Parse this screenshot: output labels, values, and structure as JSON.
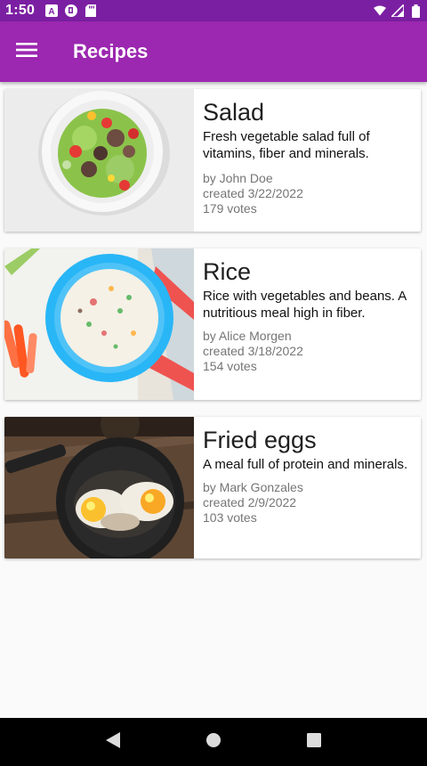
{
  "status_bar": {
    "time": "1:50",
    "left_icons": [
      "a-icon",
      "cast-icon",
      "sd-card-icon"
    ],
    "right_icons": [
      "wifi-icon",
      "signal-icon",
      "battery-icon"
    ]
  },
  "app_bar": {
    "title": "Recipes",
    "menu_icon": "hamburger-menu-icon",
    "color": "#9c27b0"
  },
  "recipes": [
    {
      "title": "Salad",
      "description": "Fresh vegetable salad full of vitamins, fiber and minerals.",
      "author": "by John Doe",
      "created": "created 3/22/2022",
      "votes": "179 votes",
      "image": "salad-photo"
    },
    {
      "title": "Rice",
      "description": "Rice with vegetables and beans. A nutritious meal high in fiber.",
      "author": "by Alice Morgen",
      "created": "created 3/18/2022",
      "votes": "154 votes",
      "image": "rice-photo"
    },
    {
      "title": "Fried eggs",
      "description": "A meal full of protein and minerals.",
      "author": "by Mark Gonzales",
      "created": "created 2/9/2022",
      "votes": "103 votes",
      "image": "fried-eggs-photo"
    }
  ],
  "nav_bar": {
    "buttons": [
      "back-icon",
      "home-icon",
      "recents-icon"
    ]
  }
}
